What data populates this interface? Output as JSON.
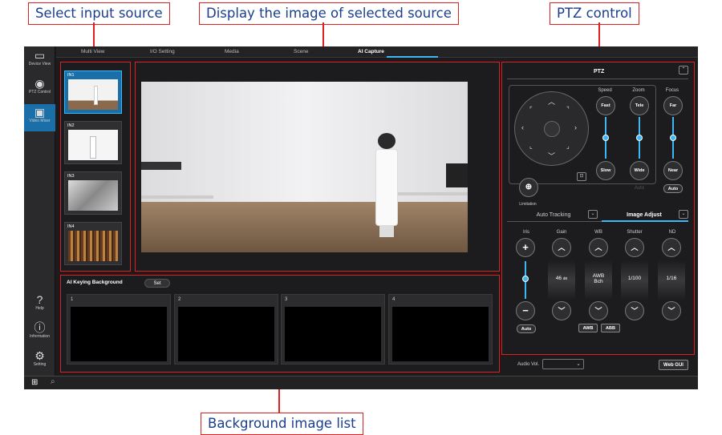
{
  "callouts": {
    "input": "Select input source",
    "display": "Display the image of selected source",
    "ptz": "PTZ control",
    "bglist": "Background image list"
  },
  "sidebar": {
    "device_view": "Device View",
    "ptz_control": "PTZ Control",
    "video_mixer": "Video Mixer",
    "help": "Help",
    "information": "Information",
    "setting": "Setting"
  },
  "tabs": [
    "Multi View",
    "I/O Setting",
    "Media",
    "Scene",
    "AI Capture"
  ],
  "inputs": [
    {
      "label": "IN1"
    },
    {
      "label": "IN2"
    },
    {
      "label": "IN3"
    },
    {
      "label": "IN4"
    }
  ],
  "background": {
    "title": "AI Keying Background",
    "set": "Set",
    "slots": [
      "1",
      "2",
      "3",
      "4"
    ]
  },
  "ptz": {
    "title": "PTZ",
    "speed": "Speed",
    "zoom": "Zoom",
    "focus": "Focus",
    "fast": "Fast",
    "tele": "Tele",
    "far": "Far",
    "slow": "Slow",
    "wide": "Wide",
    "near": "Near",
    "auto_gray": "Auto",
    "auto_focus": "Auto",
    "limitation": "Limitation",
    "auto_tracking": "Auto Tracking",
    "image_adjust": "Image Adjust"
  },
  "adjust": {
    "iris": "Iris",
    "gain": "Gain",
    "wb": "WB",
    "shutter": "Shutter",
    "nd": "ND",
    "gain_val": "46",
    "gain_unit": "dB",
    "wb_val": "AWB",
    "wb_sub": "Bch",
    "shutter_val": "1/100",
    "nd_val": "1/16",
    "auto": "Auto",
    "awb": "AWB",
    "abb": "ABB"
  },
  "bottom": {
    "audio": "Audio Vol.",
    "webgui": "Web GUI"
  },
  "colors": {
    "accent": "#3db8f5",
    "selected": "#1b6fa8",
    "callout_border": "#e02020",
    "callout_text": "#1a3d8f"
  }
}
